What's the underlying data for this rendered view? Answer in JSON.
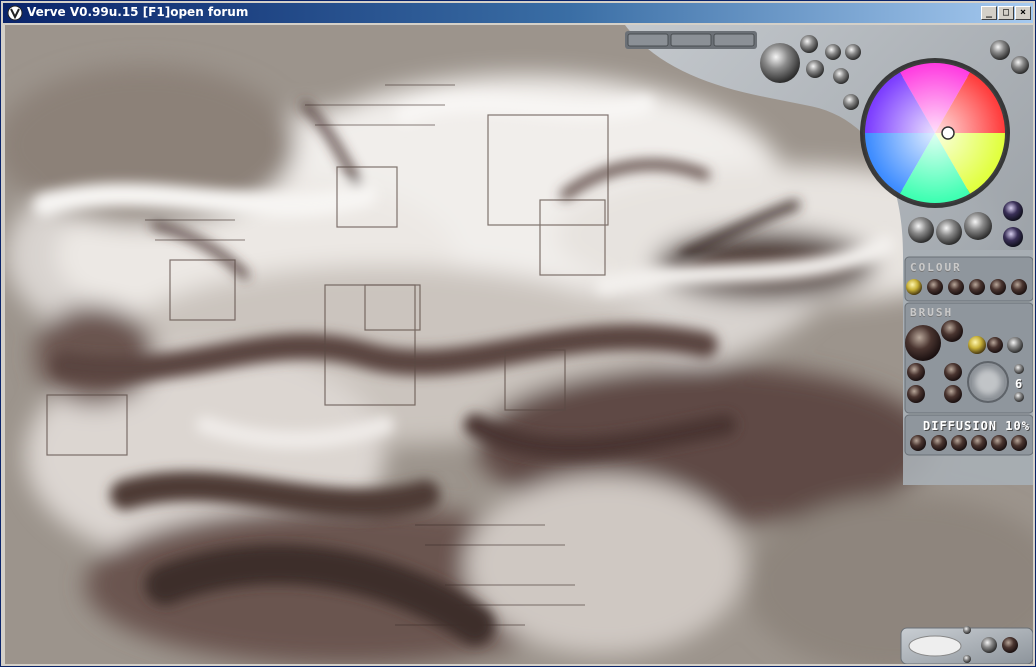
{
  "window": {
    "title": "Verve V0.99u.15 [F1]open forum",
    "minimize_glyph": "_",
    "maximize_glyph": "□",
    "close_glyph": "×"
  },
  "panels": {
    "colour_label": "COLOUR",
    "brush_label": "BRUSH",
    "diffusion_label": "DIFFUSION",
    "diffusion_value": "10%",
    "brush_size": "6"
  },
  "colors": {
    "titlebar_start": "#0a246a",
    "titlebar_end": "#a6caf0",
    "panel_metal": "#a9afb5",
    "paint_dark": "#5a4540",
    "paint_light": "#f4f1ee",
    "accent_yellow": "#c9b23a"
  },
  "icons": {
    "app": "verve-logo-icon",
    "wheel": "color-wheel-icon",
    "brush_preview": "brush-preview-icon"
  }
}
